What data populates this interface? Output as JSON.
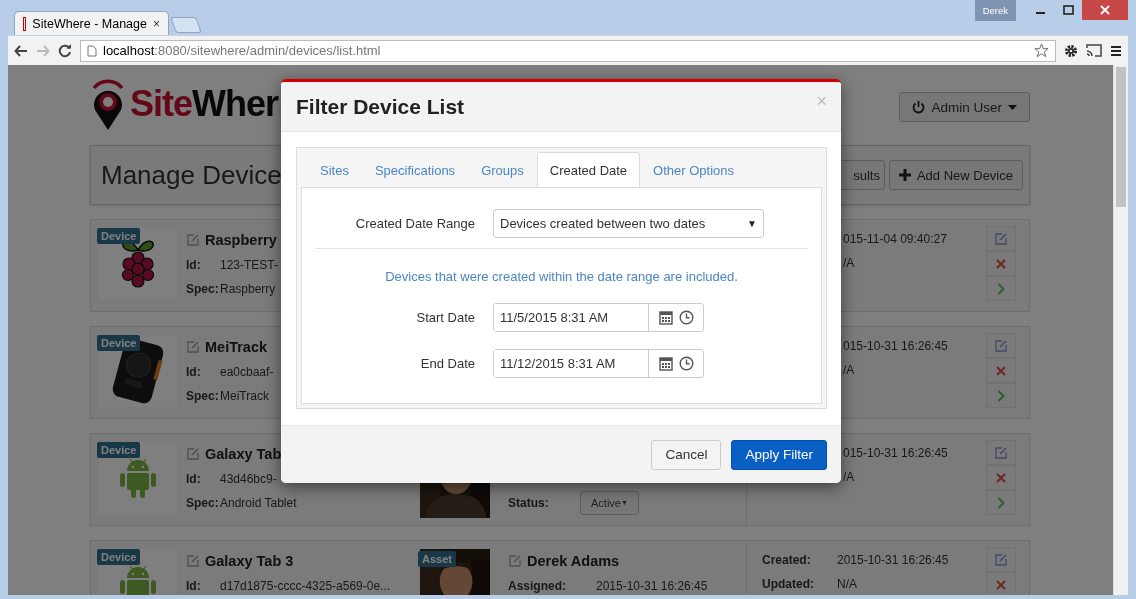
{
  "browser": {
    "tab_title": "SiteWhere - Manage",
    "tab_close": "×",
    "profile": "Derek",
    "url_host": "localhost",
    "url_path": ":8080/sitewhere/admin/devices/list.html"
  },
  "header": {
    "logo_red": "Site",
    "logo_dark": "Wher",
    "user_button": "Admin User"
  },
  "page_title": "Manage Device",
  "toolbar_buttons": [
    {
      "label": "sults",
      "kind": "plain"
    },
    {
      "label": "Add New Device",
      "kind": "add"
    }
  ],
  "devices": [
    {
      "badge": "Device",
      "kind": "raspberry",
      "name": "Raspberry",
      "id_label": "Id:",
      "id": "123-TEST-",
      "spec_label": "Spec:",
      "spec": "Raspberry",
      "created": "015-11-04 09:40:27",
      "updated": "/A",
      "actions": [
        {
          "kind": "edit"
        },
        {
          "kind": "delete"
        },
        {
          "kind": "open"
        }
      ]
    },
    {
      "badge": "Device",
      "kind": "tracker",
      "name": "MeiTrack",
      "id_label": "Id:",
      "id": "ea0cbaaf-",
      "spec_label": "Spec:",
      "spec": "MeiTrack",
      "created": "015-10-31 16:26:45",
      "updated": "/A",
      "actions": [
        {
          "kind": "edit"
        },
        {
          "kind": "delete"
        },
        {
          "kind": "open"
        }
      ]
    },
    {
      "badge": "Device",
      "kind": "android",
      "name": "Galaxy Tab",
      "id_label": "Id:",
      "id": "43d46bc9-",
      "spec_label": "Spec:",
      "spec": "Android Tablet",
      "asset": {
        "status_label": "Status:",
        "status": "Active",
        "status_caret": "▼"
      },
      "created": "015-10-31 16:26:45",
      "updated": "/A",
      "actions": [
        {
          "kind": "edit"
        },
        {
          "kind": "delete"
        },
        {
          "kind": "open"
        }
      ]
    },
    {
      "badge": "Device",
      "kind": "android",
      "name": "Galaxy Tab 3",
      "id_label": "Id:",
      "id": "d17d1875-cccc-4325-a569-0e...",
      "asset": {
        "badge": "Asset",
        "name": "Derek Adams",
        "assigned_label": "Assigned:",
        "assigned": "2015-10-31 16:26:45"
      },
      "created_label": "Created:",
      "created": "2015-10-31 16:26:45",
      "updated_label": "Updated:",
      "updated": "N/A",
      "actions": [
        {
          "kind": "edit"
        },
        {
          "kind": "delete"
        }
      ]
    }
  ],
  "modal": {
    "title": "Filter Device List",
    "close": "×",
    "tabs": [
      {
        "label": "Sites",
        "selected": false
      },
      {
        "label": "Specifications",
        "selected": false
      },
      {
        "label": "Groups",
        "selected": false
      },
      {
        "label": "Created Date",
        "selected": true
      },
      {
        "label": "Other Options",
        "selected": false
      }
    ],
    "range_label": "Created Date Range",
    "range_value": "Devices created between two dates",
    "range_caret": "▼",
    "hint": "Devices that were created within the date range are included.",
    "dates": [
      {
        "label": "Start Date",
        "value": "11/5/2015 8:31 AM"
      },
      {
        "label": "End Date",
        "value": "11/12/2015 8:31 AM"
      }
    ],
    "buttons": [
      {
        "label": "Cancel",
        "kind": "default"
      },
      {
        "label": "Apply Filter",
        "kind": "primary"
      }
    ]
  }
}
